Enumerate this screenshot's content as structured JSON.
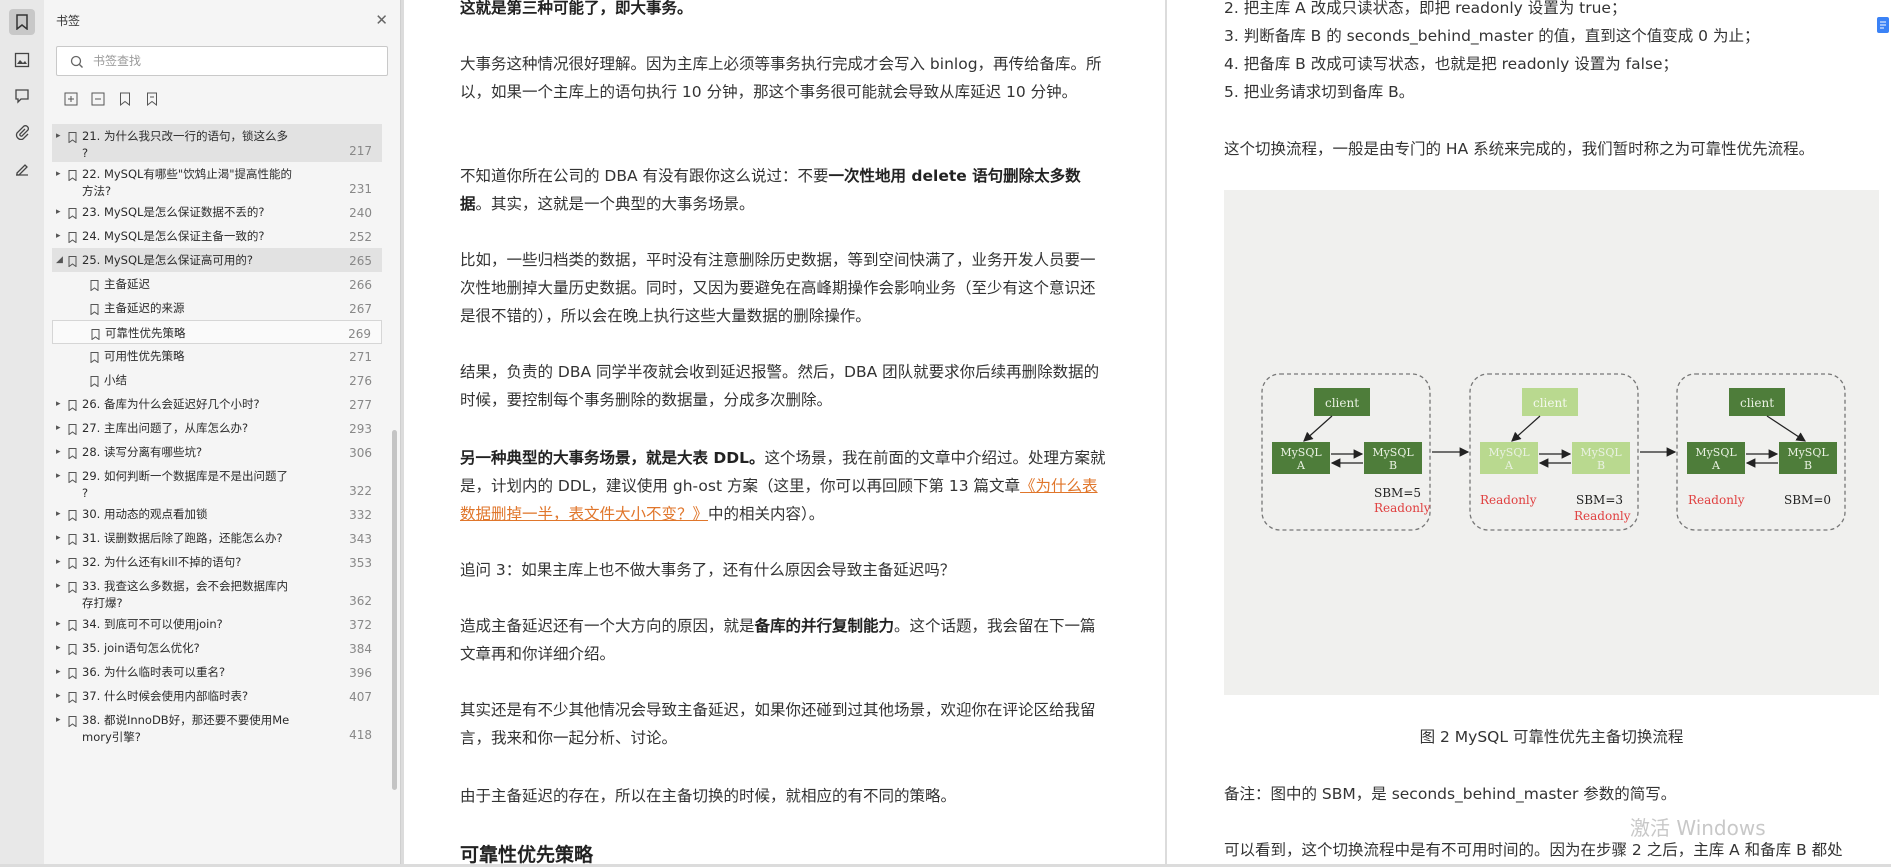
{
  "rail": {
    "icons": [
      "bookmark-icon",
      "image-icon",
      "comment-icon",
      "attachment-icon",
      "signature-icon"
    ]
  },
  "panel": {
    "title": "书签",
    "search_placeholder": "书签查找",
    "toolbar_icons": [
      "expand-all-icon",
      "collapse-all-icon",
      "add-bookmark-icon",
      "bookmark-icon"
    ],
    "items": [
      {
        "label": "21. 为什么我只改一行的语句，锁这么多\n?",
        "page": "217",
        "level": 0,
        "expanded": false,
        "highlight": true
      },
      {
        "label": "22. MySQL有哪些\"饮鸩止渴\"提高性能的\n方法?",
        "page": "231",
        "level": 0,
        "expanded": false,
        "highlight": false
      },
      {
        "label": "23. MySQL是怎么保证数据不丢的?",
        "page": "240",
        "level": 0,
        "expanded": false,
        "highlight": false
      },
      {
        "label": "24. MySQL是怎么保证主备一致的?",
        "page": "252",
        "level": 0,
        "expanded": false,
        "highlight": false
      },
      {
        "label": "25. MySQL是怎么保证高可用的?",
        "page": "265",
        "level": 0,
        "expanded": true,
        "highlight": true
      },
      {
        "label": "主备延迟",
        "page": "266",
        "level": 1,
        "expanded": false,
        "highlight": false
      },
      {
        "label": "主备延迟的来源",
        "page": "267",
        "level": 1,
        "expanded": false,
        "highlight": false
      },
      {
        "label": "可靠性优先策略",
        "page": "269",
        "level": 1,
        "expanded": false,
        "highlight": false,
        "selected": true
      },
      {
        "label": "可用性优先策略",
        "page": "271",
        "level": 1,
        "expanded": false,
        "highlight": false
      },
      {
        "label": "小结",
        "page": "276",
        "level": 1,
        "expanded": false,
        "highlight": false
      },
      {
        "label": "26. 备库为什么会延迟好几个小时?",
        "page": "277",
        "level": 0,
        "expanded": false,
        "highlight": false
      },
      {
        "label": "27. 主库出问题了，从库怎么办?",
        "page": "293",
        "level": 0,
        "expanded": false,
        "highlight": false
      },
      {
        "label": "28. 读写分离有哪些坑?",
        "page": "306",
        "level": 0,
        "expanded": false,
        "highlight": false
      },
      {
        "label": "29. 如何判断一个数据库是不是出问题了\n?",
        "page": "322",
        "level": 0,
        "expanded": false,
        "highlight": false
      },
      {
        "label": "30. 用动态的观点看加锁",
        "page": "332",
        "level": 0,
        "expanded": false,
        "highlight": false
      },
      {
        "label": "31. 误删数据后除了跑路，还能怎么办?",
        "page": "343",
        "level": 0,
        "expanded": false,
        "highlight": false
      },
      {
        "label": "32. 为什么还有kill不掉的语句?",
        "page": "353",
        "level": 0,
        "expanded": false,
        "highlight": false
      },
      {
        "label": "33. 我查这么多数据，会不会把数据库内\n存打爆?",
        "page": "362",
        "level": 0,
        "expanded": false,
        "highlight": false
      },
      {
        "label": "34. 到底可不可以使用join?",
        "page": "372",
        "level": 0,
        "expanded": false,
        "highlight": false
      },
      {
        "label": "35. join语句怎么优化?",
        "page": "384",
        "level": 0,
        "expanded": false,
        "highlight": false
      },
      {
        "label": "36. 为什么临时表可以重名?",
        "page": "396",
        "level": 0,
        "expanded": false,
        "highlight": false
      },
      {
        "label": "37. 什么时候会使用内部临时表?",
        "page": "407",
        "level": 0,
        "expanded": false,
        "highlight": false
      },
      {
        "label": "38. 都说InnoDB好，那还要不要使用Me\nmory引擎?",
        "page": "418",
        "level": 0,
        "expanded": false,
        "highlight": false
      }
    ]
  },
  "page1": {
    "p0": "这就是第三种可能了，即大事务。",
    "p1": "大事务这种情况很好理解。因为主库上必须等事务执行完成才会写入 binlog，再传给备库。所以，如果一个主库上的语句执行 10 分钟，那这个事务很可能就会导致从库延迟 10 分钟。",
    "p2a": "不知道你所在公司的 DBA 有没有跟你这么说过：不要",
    "p2b": "一次性地用 delete 语句删除太多数据",
    "p2c": "。其实，这就是一个典型的大事务场景。",
    "p3": "比如，一些归档类的数据，平时没有注意删除历史数据，等到空间快满了，业务开发人员要一次性地删掉大量历史数据。同时，又因为要避免在高峰期操作会影响业务（至少有这个意识还是很不错的），所以会在晚上执行这些大量数据的删除操作。",
    "p4": "结果，负责的 DBA 同学半夜就会收到延迟报警。然后，DBA 团队就要求你后续再删除数据的时候，要控制每个事务删除的数据量，分成多次删除。",
    "p5a": "另一种典型的大事务场景，就是大表 DDL。",
    "p5b": "这个场景，我在前面的文章中介绍过。处理方案就是，计划内的 DDL，建议使用 gh-ost 方案（这里，你可以再回顾下第 13 篇文章",
    "p5link": "《为什么表数据删掉一半，表文件大小不变？》",
    "p5c": "中的相关内容）。",
    "p6": "追问 3：如果主库上也不做大事务了，还有什么原因会导致主备延迟吗？",
    "p7a": "造成主备延迟还有一个大方向的原因，就是",
    "p7b": "备库的并行复制能力",
    "p7c": "。这个话题，我会留在下一篇文章再和你详细介绍。",
    "p8": "其实还是有不少其他情况会导致主备延迟，如果你还碰到过其他场景，欢迎你在评论区给我留言，我来和你一起分析、讨论。",
    "p9": "由于主备延迟的存在，所以在主备切换的时候，就相应的有不同的策略。",
    "h": "可靠性优先策略"
  },
  "page2": {
    "l1": "2. 把主库 A 改成只读状态，即把 readonly 设置为 true；",
    "l2": "3. 判断备库 B 的 seconds_behind_master 的值，直到这个值变成 0 为止；",
    "l3": "4. 把备库 B 改成可读写状态，也就是把 readonly 设置为 false；",
    "l4": "5. 把业务请求切到备库 B。",
    "p1": "这个切换流程，一般是由专门的 HA 系统来完成的，我们暂时称之为可靠性优先流程。",
    "caption": "图 2 MySQL 可靠性优先主备切换流程",
    "p2": "备注：图中的 SBM，是 seconds_behind_master 参数的简写。",
    "p3": "可以看到，这个切换流程中是有不可用时间的。因为在步骤 2 之后，主库 A 和备库 B 都处"
  },
  "figure": {
    "client": "client",
    "mysql_a_1": "MySQL",
    "mysql_a_2": "A",
    "mysql_b_1": "MySQL",
    "mysql_b_2": "B",
    "p1_sbm": "SBM=5",
    "p1_ro": "Readonly",
    "p2_ro_a": "Readonly",
    "p2_sbm": "SBM=3",
    "p2_ro_b": "Readonly",
    "p3_ro": "Readonly",
    "p3_sbm": "SBM=0",
    "colors": {
      "dark": "#4e7d3a",
      "light": "#b9d98f",
      "red": "#e04040"
    }
  },
  "watermark": "激活 Windows"
}
